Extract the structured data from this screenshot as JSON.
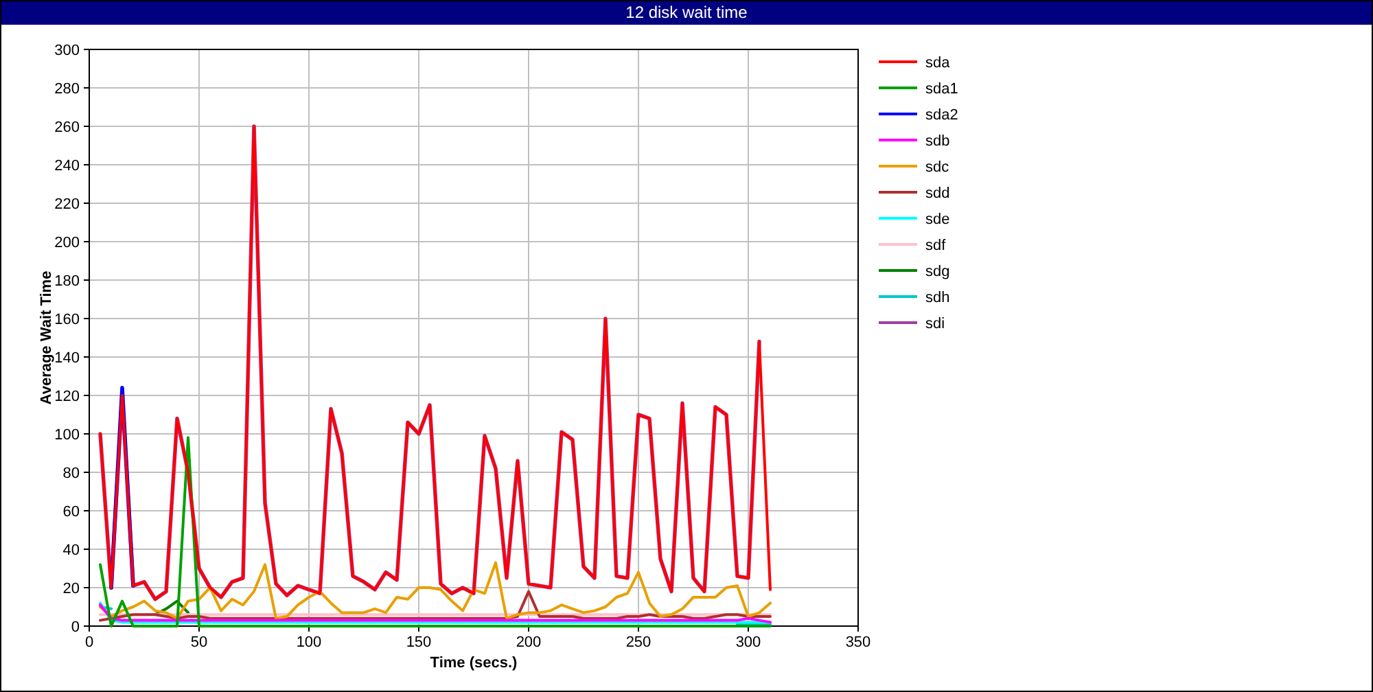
{
  "window": {
    "title": "12 disk wait time"
  },
  "chart": {
    "chart_data": {
      "type": "line",
      "xlabel": "Time (secs.)",
      "ylabel": "Average Wait Time",
      "x": [
        5,
        10,
        15,
        20,
        25,
        30,
        35,
        40,
        45,
        50,
        55,
        60,
        65,
        70,
        75,
        80,
        85,
        90,
        95,
        100,
        105,
        110,
        115,
        120,
        125,
        130,
        135,
        140,
        145,
        150,
        155,
        160,
        165,
        170,
        175,
        180,
        185,
        190,
        195,
        200,
        205,
        210,
        215,
        220,
        225,
        230,
        235,
        240,
        245,
        250,
        255,
        260,
        265,
        270,
        275,
        280,
        285,
        290,
        295,
        300,
        305,
        310
      ],
      "grid": true,
      "legend": true,
      "xlim": [
        0,
        350
      ],
      "ylim": [
        0,
        300
      ],
      "xticks": [
        0,
        50,
        100,
        150,
        200,
        250,
        300,
        350
      ],
      "yticks": [
        0,
        20,
        40,
        60,
        80,
        100,
        120,
        140,
        160,
        180,
        200,
        220,
        240,
        260,
        280,
        300
      ],
      "series": [
        {
          "name": "sda",
          "color": "#ff0000",
          "values": [
            100,
            20,
            120,
            21,
            23,
            14,
            18,
            108,
            80,
            30,
            20,
            15,
            23,
            25,
            260,
            64,
            22,
            16,
            21,
            19,
            17,
            113,
            90,
            26,
            23,
            19,
            28,
            24,
            106,
            100,
            115,
            22,
            17,
            20,
            17,
            99,
            82,
            25,
            86,
            22,
            21,
            20,
            101,
            97,
            31,
            25,
            160,
            26,
            25,
            110,
            108,
            35,
            18,
            116,
            25,
            18,
            114,
            110,
            26,
            25,
            148,
            19
          ]
        },
        {
          "name": "sda1",
          "color": "#00a000",
          "values": [
            32,
            0,
            13,
            0,
            0,
            0,
            0,
            0,
            98,
            0,
            0,
            0,
            0,
            0,
            0,
            0,
            0,
            0,
            0,
            0,
            0,
            0,
            0,
            0,
            0,
            0,
            0,
            0,
            0,
            0,
            0,
            0,
            0,
            0,
            0,
            0,
            0,
            0,
            0,
            0,
            0,
            0,
            0,
            0,
            0,
            0,
            0,
            0,
            0,
            0,
            0,
            0,
            0,
            0,
            0,
            0,
            0,
            0,
            0,
            0,
            0,
            0
          ]
        },
        {
          "name": "sda2",
          "color": "#0000ff",
          "values": [
            null,
            20,
            124,
            21,
            null,
            null,
            null,
            null,
            null,
            null,
            null,
            null,
            null,
            null,
            null,
            null,
            null,
            null,
            null,
            null,
            null,
            null,
            null,
            null,
            null,
            null,
            null,
            null,
            null,
            null,
            null,
            null,
            null,
            null,
            null,
            null,
            null,
            null,
            null,
            null,
            null,
            null,
            null,
            null,
            null,
            null,
            null,
            null,
            null,
            null,
            null,
            null,
            null,
            null,
            null,
            null,
            null,
            null,
            null,
            null,
            null,
            null
          ]
        },
        {
          "name": "sdb",
          "color": "#ff00ff",
          "values": [
            11,
            4,
            3,
            3,
            3,
            3,
            3,
            3,
            3,
            3,
            3,
            3,
            3,
            3,
            3,
            3,
            3,
            3,
            3,
            3,
            3,
            3,
            3,
            3,
            3,
            3,
            3,
            3,
            3,
            3,
            3,
            3,
            3,
            3,
            3,
            3,
            3,
            3,
            3,
            3,
            3,
            3,
            3,
            3,
            3,
            3,
            3,
            3,
            3,
            3,
            3,
            3,
            3,
            3,
            3,
            3,
            3,
            3,
            3,
            4,
            3,
            2
          ]
        },
        {
          "name": "sdc",
          "color": "#e8a000",
          "values": [
            10,
            5,
            8,
            10,
            13,
            8,
            7,
            4,
            13,
            14,
            20,
            8,
            14,
            11,
            18,
            32,
            4,
            5,
            11,
            15,
            18,
            12,
            7,
            7,
            7,
            9,
            7,
            15,
            14,
            20,
            20,
            19,
            13,
            8,
            19,
            17,
            33,
            4,
            6,
            7,
            7,
            8,
            11,
            9,
            7,
            8,
            10,
            15,
            17,
            28,
            12,
            5,
            6,
            9,
            15,
            15,
            15,
            20,
            21,
            5,
            7,
            12
          ]
        },
        {
          "name": "sdd",
          "color": "#b03030",
          "values": [
            3,
            4,
            5,
            6,
            6,
            6,
            5,
            4,
            5,
            5,
            4,
            4,
            4,
            4,
            4,
            4,
            4,
            4,
            4,
            4,
            4,
            4,
            4,
            4,
            4,
            4,
            4,
            4,
            4,
            4,
            4,
            4,
            4,
            4,
            4,
            4,
            4,
            4,
            5,
            18,
            5,
            5,
            5,
            5,
            4,
            4,
            4,
            4,
            5,
            5,
            6,
            5,
            5,
            5,
            4,
            4,
            5,
            6,
            6,
            5,
            5,
            5
          ]
        },
        {
          "name": "sde",
          "color": "#00ffff",
          "values": [
            12,
            3,
            2,
            2,
            2,
            2,
            2,
            2,
            2,
            2,
            2,
            2,
            2,
            2,
            2,
            2,
            2,
            2,
            2,
            2,
            2,
            2,
            2,
            2,
            2,
            2,
            2,
            2,
            2,
            2,
            2,
            2,
            2,
            2,
            2,
            2,
            2,
            2,
            2,
            2,
            2,
            2,
            2,
            2,
            2,
            2,
            2,
            2,
            2,
            2,
            2,
            2,
            2,
            2,
            2,
            2,
            2,
            2,
            2,
            2,
            2,
            2
          ]
        },
        {
          "name": "sdf",
          "color": "#ffc0cb",
          "values": [
            6,
            6,
            6,
            6,
            6,
            6,
            6,
            6,
            6,
            6,
            6,
            6,
            6,
            6,
            6,
            6,
            6,
            6,
            6,
            6,
            6,
            6,
            6,
            6,
            6,
            6,
            6,
            6,
            6,
            6,
            6,
            6,
            6,
            6,
            6,
            6,
            6,
            6,
            6,
            6,
            6,
            6,
            6,
            6,
            6,
            6,
            6,
            6,
            6,
            6,
            6,
            6,
            6,
            6,
            6,
            6,
            6,
            6,
            6,
            6,
            6,
            6
          ]
        },
        {
          "name": "sdg",
          "color": "#008000",
          "values": [
            null,
            null,
            null,
            null,
            null,
            6,
            9,
            13,
            7,
            null,
            null,
            null,
            null,
            null,
            null,
            null,
            null,
            null,
            null,
            null,
            null,
            null,
            null,
            null,
            null,
            null,
            null,
            null,
            null,
            null,
            null,
            null,
            null,
            null,
            null,
            null,
            null,
            null,
            null,
            null,
            null,
            null,
            null,
            null,
            null,
            null,
            null,
            null,
            null,
            null,
            null,
            null,
            null,
            null,
            null,
            null,
            null,
            null,
            null,
            null,
            null,
            null
          ]
        },
        {
          "name": "sdh",
          "color": "#00c8c8",
          "values": [
            10,
            9,
            null,
            null,
            null,
            null,
            null,
            null,
            null,
            null,
            null,
            null,
            null,
            null,
            null,
            null,
            null,
            null,
            null,
            null,
            null,
            null,
            null,
            null,
            null,
            null,
            null,
            null,
            null,
            null,
            null,
            null,
            null,
            null,
            null,
            null,
            null,
            null,
            null,
            null,
            null,
            null,
            null,
            null,
            null,
            null,
            null,
            null,
            null,
            null,
            null,
            null,
            null,
            null,
            null,
            null,
            null,
            null,
            1,
            1,
            1,
            1
          ]
        },
        {
          "name": "sdi",
          "color": "#a040a0",
          "values": [
            100,
            20,
            120,
            21,
            23,
            14,
            18,
            108,
            80,
            30,
            20,
            15,
            23,
            25,
            260,
            64,
            22,
            16,
            21,
            19,
            17,
            113,
            90,
            26,
            23,
            19,
            28,
            24,
            106,
            100,
            115,
            22,
            17,
            20,
            17,
            99,
            82,
            25,
            86,
            22,
            21,
            20,
            101,
            97,
            31,
            25,
            160,
            26,
            25,
            110,
            108,
            35,
            18,
            116,
            25,
            18,
            114,
            110,
            26,
            25,
            148,
            null
          ]
        }
      ]
    }
  }
}
